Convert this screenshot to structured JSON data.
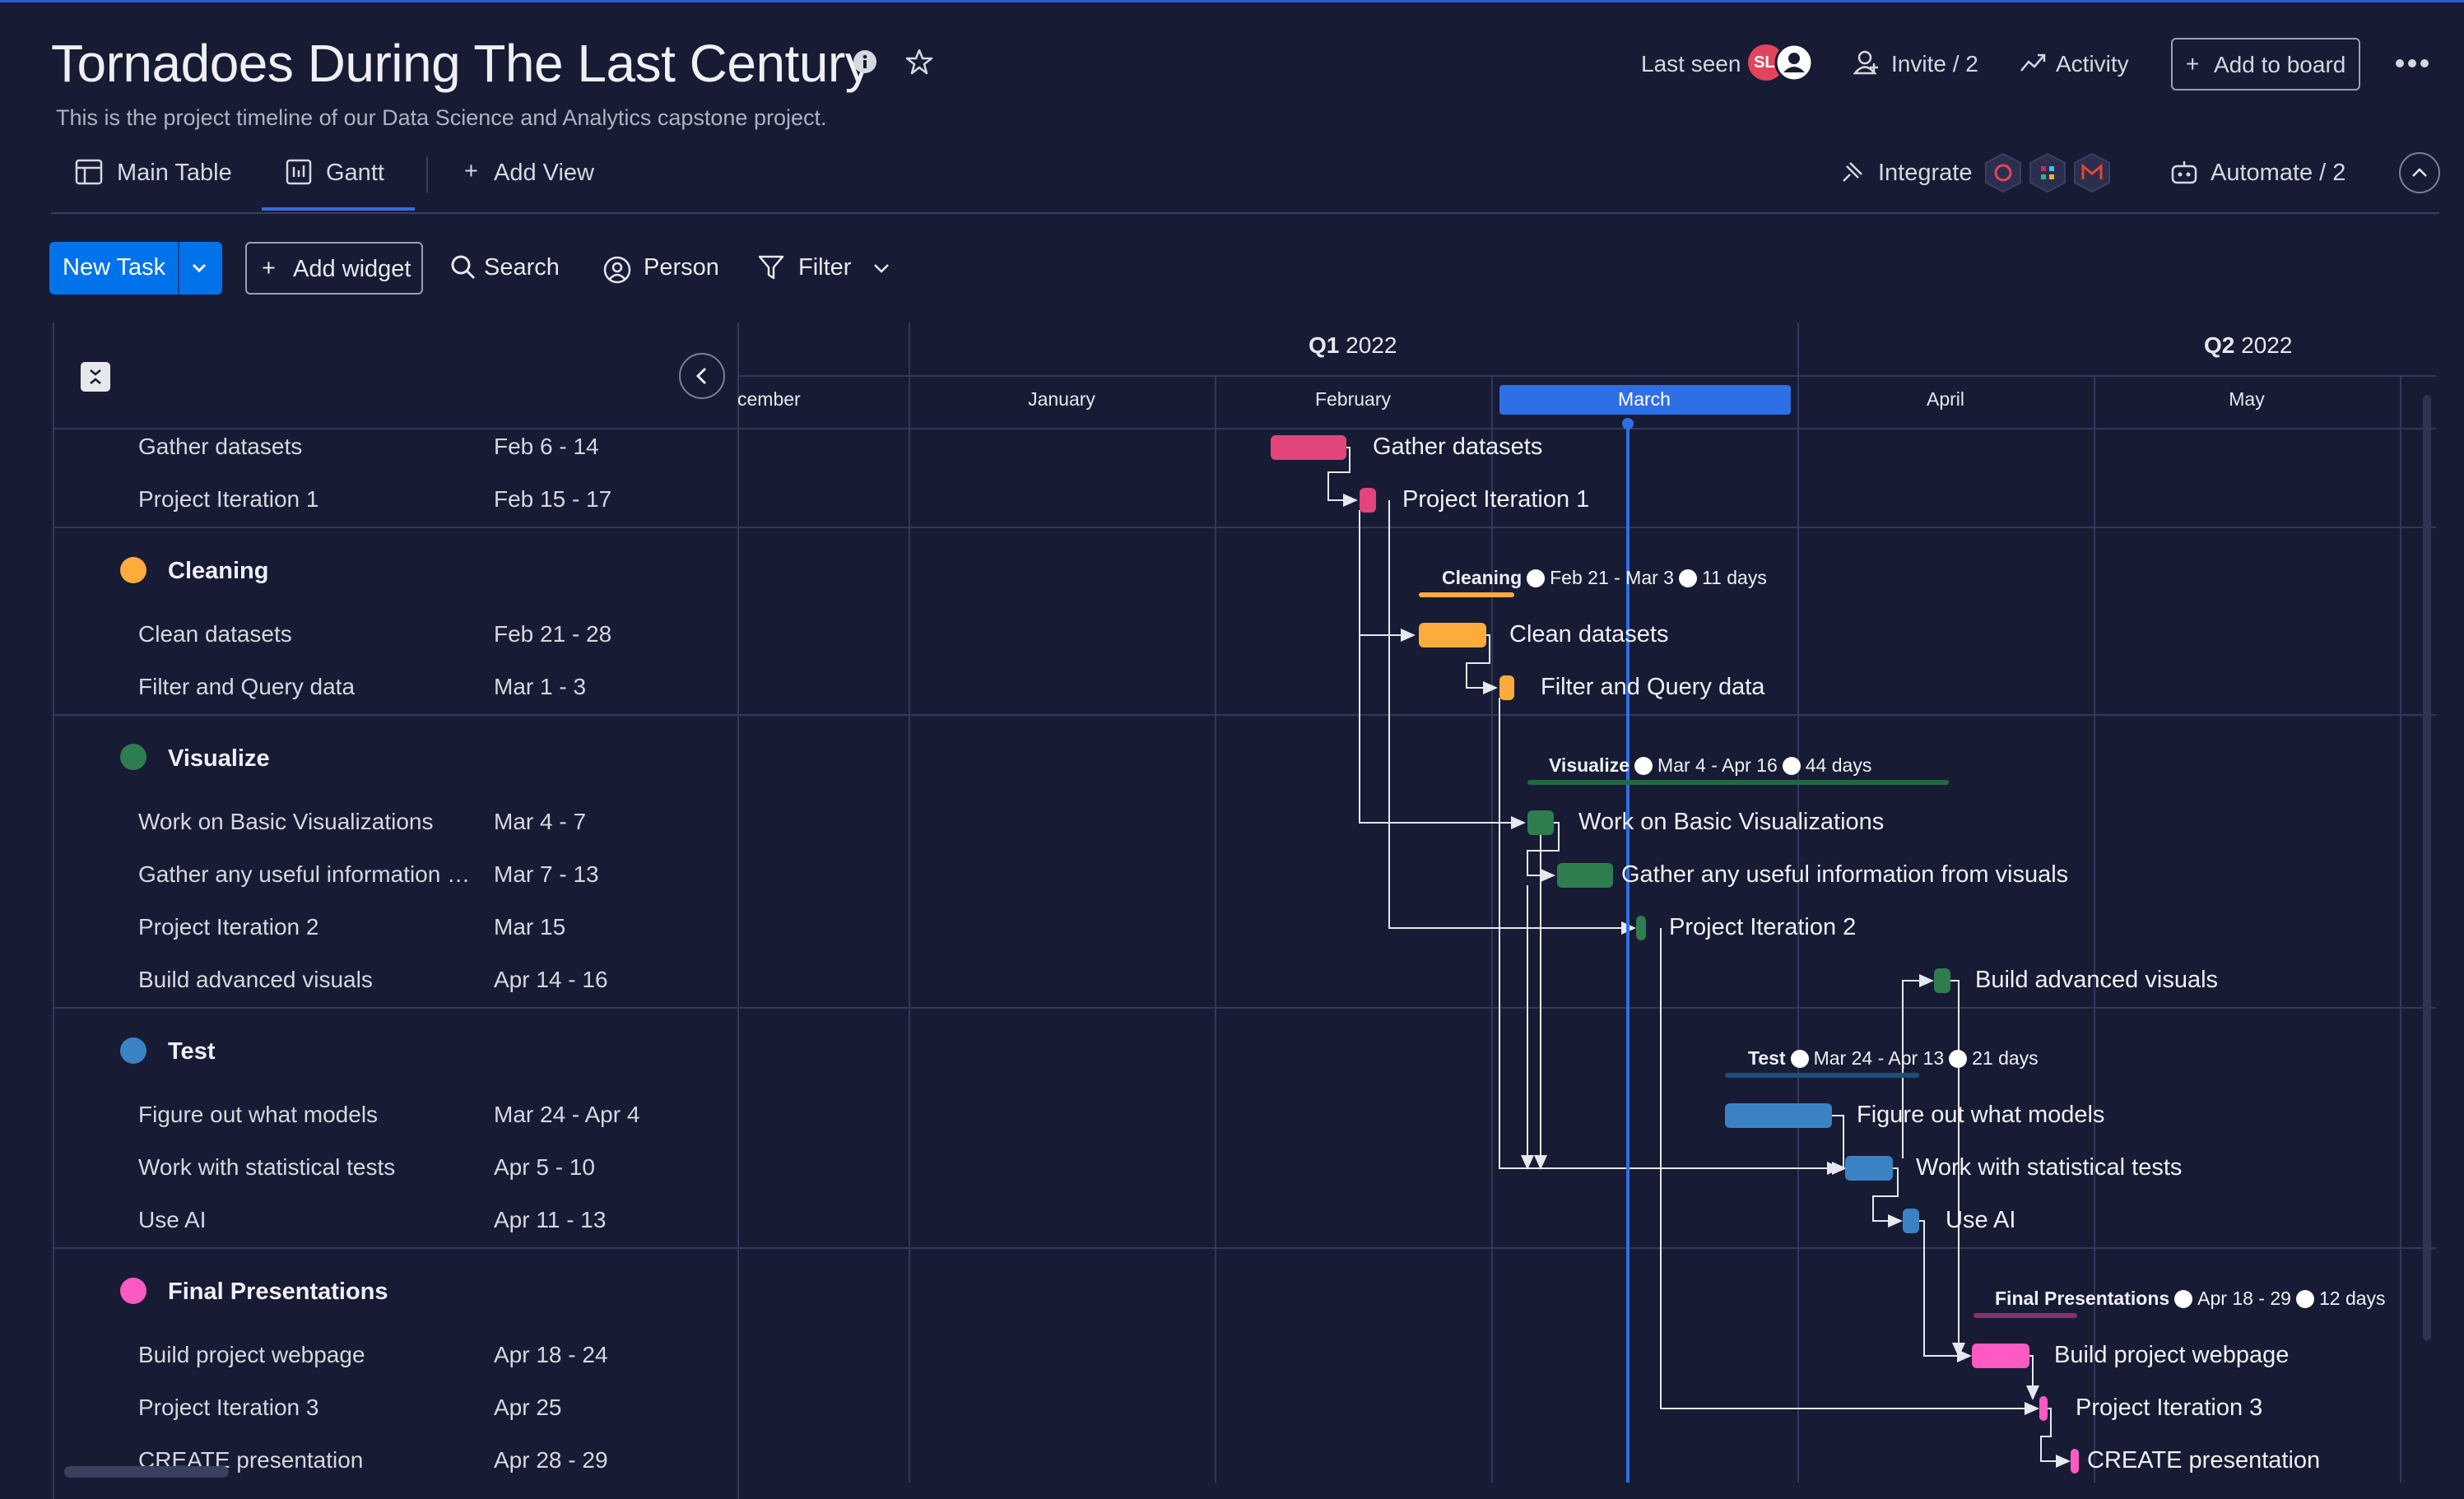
{
  "board": {
    "title": "Tornadoes During The Last Century",
    "description": "This is the project timeline of our Data Science and Analytics capstone project.",
    "last_seen_label": "Last seen",
    "avatar_initials": "SL",
    "invite_label": "Invite / 2",
    "activity_label": "Activity",
    "add_to_board_label": "Add to board"
  },
  "views": {
    "tabs": [
      {
        "label": "Main Table"
      },
      {
        "label": "Gantt"
      }
    ],
    "add_view_label": "Add View",
    "active_tab": "Gantt",
    "integrate_label": "Integrate",
    "automate_label": "Automate / 2"
  },
  "toolbar": {
    "new_task_label": "New Task",
    "add_widget_label": "Add widget",
    "search_label": "Search",
    "person_label": "Person",
    "filter_label": "Filter"
  },
  "timeline": {
    "quarters": [
      {
        "label_bold": "Q1",
        "label_year": "2022"
      },
      {
        "label_bold": "Q2",
        "label_year": "2022"
      }
    ],
    "months": [
      "cember",
      "January",
      "February",
      "March",
      "April",
      "May"
    ],
    "current_month": "March"
  },
  "rows": {
    "ungrouped": [
      {
        "name": "Gather datasets",
        "dates": "Feb 6 - 14"
      },
      {
        "name": "Project Iteration 1",
        "dates": "Feb 15 - 17"
      }
    ],
    "groups": [
      {
        "name": "Cleaning",
        "color": "#fdab3d",
        "summary_dates": "Feb 21 - Mar 3",
        "summary_days": "11 days",
        "items": [
          {
            "name": "Clean datasets",
            "dates": "Feb 21 - 28"
          },
          {
            "name": "Filter and Query data",
            "dates": "Mar 1 - 3"
          }
        ]
      },
      {
        "name": "Visualize",
        "color": "#037f4c",
        "summary_dates": "Mar 4 - Apr 16",
        "summary_days": "44 days",
        "items": [
          {
            "name": "Work on Basic Visualizations",
            "dates": "Mar 4 - 7"
          },
          {
            "name": "Gather any useful information from visuals",
            "dates": "Mar 7 - 13"
          },
          {
            "name": "Project Iteration 2",
            "dates": "Mar 15"
          },
          {
            "name": "Build advanced visuals",
            "dates": "Apr 14 - 16"
          }
        ]
      },
      {
        "name": "Test",
        "color": "#579bfc",
        "summary_dates": "Mar 24 - Apr 13",
        "summary_days": "21 days",
        "items": [
          {
            "name": "Figure out what models",
            "dates": "Mar 24 - Apr 4"
          },
          {
            "name": "Work with statistical tests",
            "dates": "Apr 5 - 10"
          },
          {
            "name": "Use AI",
            "dates": "Apr 11 - 13"
          }
        ]
      },
      {
        "name": "Final Presentations",
        "color": "#ff5ac4",
        "summary_dates": "Apr 18 - 29",
        "summary_days": "12 days",
        "items": [
          {
            "name": "Build project webpage",
            "dates": "Apr 18 - 24"
          },
          {
            "name": "Project Iteration 3",
            "dates": "Apr 25"
          },
          {
            "name": "CREATE presentation",
            "dates": "Apr 28 - 29"
          }
        ]
      }
    ]
  },
  "colors": {
    "background": "#181b34",
    "primary": "#0073ea",
    "today_line": "#2f6fe6",
    "pink": "#e2445c",
    "orange": "#fdab3d",
    "green": "#2e7d4f",
    "blue": "#3b82c4",
    "magenta": "#ff5ac4"
  }
}
